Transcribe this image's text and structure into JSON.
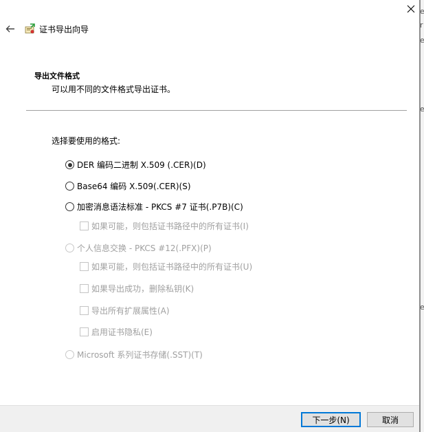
{
  "window": {
    "title": "证书导出向导",
    "close_glyph": "✕",
    "back_glyph": "←"
  },
  "section": {
    "title": "导出文件格式",
    "description": "可以用不同的文件格式导出证书。"
  },
  "prompt": "选择要使用的格式:",
  "formats": [
    {
      "label": "DER 编码二进制 X.509 (.CER)(D)",
      "selected": true,
      "enabled": true
    },
    {
      "label": "Base64 编码 X.509(.CER)(S)",
      "selected": false,
      "enabled": true
    },
    {
      "label": "加密消息语法标准 - PKCS #7 证书(.P7B)(C)",
      "selected": false,
      "enabled": true
    },
    {
      "label": "个人信息交换 - PKCS #12(.PFX)(P)",
      "selected": false,
      "enabled": false
    },
    {
      "label": "Microsoft 系列证书存储(.SST)(T)",
      "selected": false,
      "enabled": false
    }
  ],
  "options": {
    "p7b_include_chain": "如果可能，则包括证书路径中的所有证书(I)",
    "pfx_include_chain": "如果可能，则包括证书路径中的所有证书(U)",
    "pfx_delete_key": "如果导出成功，删除私钥(K)",
    "pfx_export_props": "导出所有扩展属性(A)",
    "pfx_privacy": "启用证书隐私(E)"
  },
  "buttons": {
    "next": "下一步(N)",
    "cancel": "取消"
  },
  "background_chars": [
    "e",
    "r",
    "e",
    "e",
    "e"
  ],
  "colors": {
    "accent": "#0078d7",
    "disabled_text": "#a0a0a0",
    "footer_bg": "#f0f0f0"
  }
}
